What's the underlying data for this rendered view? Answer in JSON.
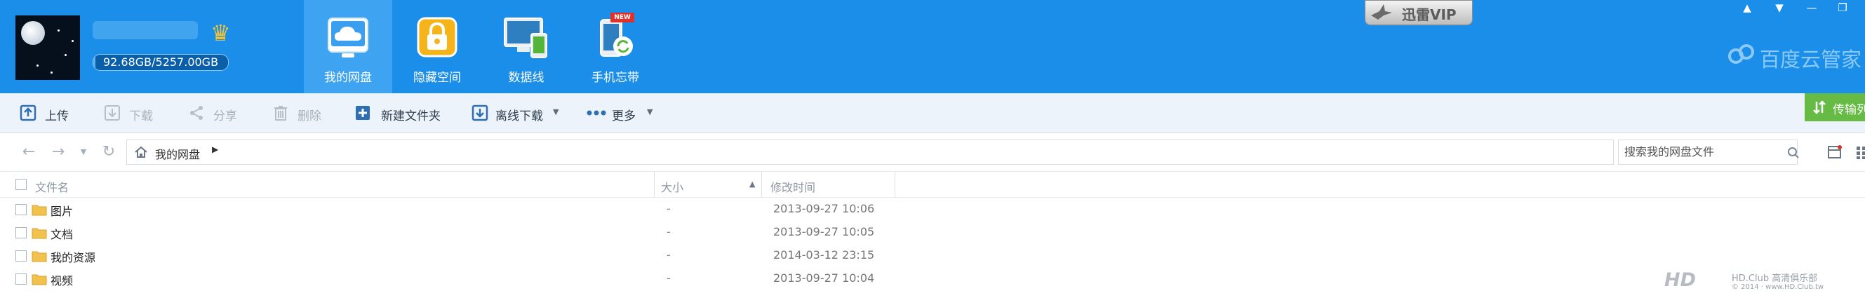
{
  "header": {
    "quota_text": "92.68GB/5257.00GB",
    "quota_used_fraction": 0.018,
    "tabs": [
      {
        "label": "我的网盘",
        "icon": "cloud-disk-icon",
        "active": true
      },
      {
        "label": "隐藏空间",
        "icon": "lock-icon",
        "active": false
      },
      {
        "label": "数据线",
        "icon": "devices-icon",
        "active": false
      },
      {
        "label": "手机忘带",
        "icon": "phone-sync-icon",
        "active": false
      }
    ],
    "new_badge": "NEW",
    "vip_label": "迅雷VIP",
    "brand": "百度云管家"
  },
  "toolbar": {
    "upload": "上传",
    "download": "下载",
    "share": "分享",
    "delete": "删除",
    "new_folder": "新建文件夹",
    "offline_download": "离线下载",
    "more": "更多",
    "transfer_list": "传输列"
  },
  "address": {
    "path": "我的网盘",
    "search_placeholder": "搜索我的网盘文件"
  },
  "columns": {
    "name": "文件名",
    "size": "大小",
    "modified": "修改时间"
  },
  "files": [
    {
      "name": "图片",
      "size": "-",
      "modified": "2013-09-27 10:06"
    },
    {
      "name": "文档",
      "size": "-",
      "modified": "2013-09-27 10:05"
    },
    {
      "name": "我的资源",
      "size": "-",
      "modified": "2014-03-12 23:15"
    },
    {
      "name": "视频",
      "size": "-",
      "modified": "2013-09-27 10:04"
    }
  ],
  "watermark": {
    "logo": "HD",
    "line1": "HD.Club 高清俱乐部",
    "line2": "© 2014 · www.HD.Club.tw"
  },
  "colors": {
    "header_bg": "#1a8ee8",
    "active_tab_bg": "#3ea3f0",
    "toolbar_bg": "#edf3fa",
    "transfer_green": "#66bb44"
  }
}
